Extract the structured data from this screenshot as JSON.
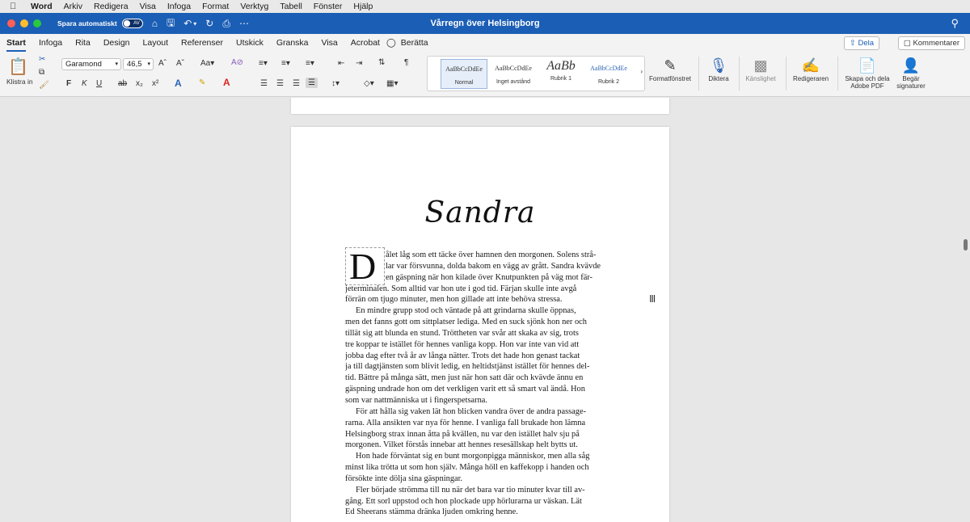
{
  "menubar": {
    "app": "Word",
    "items": [
      "Arkiv",
      "Redigera",
      "Visa",
      "Infoga",
      "Format",
      "Verktyg",
      "Tabell",
      "Fönster",
      "Hjälp"
    ]
  },
  "titlebar": {
    "autosave_label": "Spara automatiskt",
    "autosave_state": "AV",
    "title": "Vårregn över Helsingborg"
  },
  "tabs": [
    "Start",
    "Infoga",
    "Rita",
    "Design",
    "Layout",
    "Referenser",
    "Utskick",
    "Granska",
    "Visa",
    "Acrobat",
    "Berätta"
  ],
  "share_label": "Dela",
  "comment_label": "Kommentarer",
  "ribbon": {
    "paste_label": "Klistra in",
    "font_name": "Garamond",
    "font_size": "46,5",
    "styles": [
      {
        "preview": "AaBbCcDdEe",
        "label": "Normal"
      },
      {
        "preview": "AaBbCcDdEe",
        "label": "Inget avstånd"
      },
      {
        "preview": "AaBb",
        "label": "Rubrik 1"
      },
      {
        "preview": "AaBbCcDdEe",
        "label": "Rubrik 2"
      }
    ],
    "format_pane": "Formatfönstret",
    "dictate": "Diktera",
    "sensitivity": "Känslighet",
    "editor": "Redigeraren",
    "create_pdf": "Skapa och dela Adobe PDF",
    "request_sign": "Begär signaturer"
  },
  "document": {
    "heading": "Sandra",
    "dropcap": "D",
    "lines": [
      "ålet låg som ett täcke över hamnen den morgonen. Solens strå-",
      "lar var försvunna, dolda bakom en vägg av grått. Sandra kvävde",
      "en gäspning när hon kilade över Knutpunkten på väg mot fär-",
      "jeterminalen. Som alltid var hon ute i god tid. Färjan skulle inte avgå",
      "förrän om tjugo minuter, men hon gillade att inte behöva stressa.",
      "En mindre grupp stod och väntade på att grindarna skulle öppnas,",
      "men det fanns gott om sittplatser lediga. Med en suck sjönk hon ner och",
      "tillät sig att blunda en stund. Tröttheten var svår att skaka av sig, trots",
      "tre koppar te istället för hennes vanliga kopp. Hon var inte van vid att",
      "jobba dag efter två år av långa nätter. Trots det hade hon genast tackat",
      "ja till dagtjänsten som blivit ledig, en heltidstjänst istället för hennes del-",
      "tid. Bättre på många sätt, men just när hon satt där och kvävde ännu en",
      "gäspning undrade hon om det verkligen varit ett så smart val ändå. Hon",
      "som var nattmänniska ut i fingerspetsarna.",
      "För att hålla sig vaken lät hon blicken vandra över de andra passage-",
      "rarna. Alla ansikten var nya för henne. I vanliga fall brukade hon lämna",
      "Helsingborg strax innan åtta på kvällen, nu var den istället halv sju på",
      "morgonen. Vilket förstås innebar att hennes resesällskap helt bytts ut.",
      "Hon hade förväntat sig en bunt morgonpigga människor, men alla såg",
      "minst lika trötta ut som hon själv. Många höll en kaffekopp i handen och",
      "försökte inte dölja sina gäspningar.",
      "Fler började strömma till nu när det bara var tio minuter kvar till av-",
      "gång. Ett sorl uppstod och hon plockade upp hörlurarna ur väskan. Lät",
      "Ed Sheerans stämma dränka ljuden omkring henne."
    ]
  }
}
